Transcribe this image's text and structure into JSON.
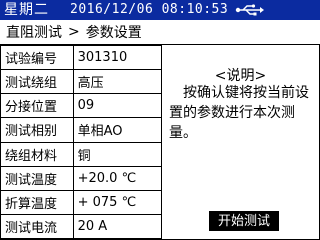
{
  "status_bar": {
    "weekday": "星期二",
    "datetime": "2016/12/06 08:10:53",
    "icon": "usb-icon",
    "bg_color": "#0b2ba0"
  },
  "breadcrumb": {
    "parent": "直阻测试",
    "separator": ">",
    "current": "参数设置"
  },
  "params": [
    {
      "label": "试验编号",
      "value": "301310"
    },
    {
      "label": "测试绕组",
      "value": "高压"
    },
    {
      "label": "分接位置",
      "value": "09"
    },
    {
      "label": "测试相别",
      "value": "单相AO"
    },
    {
      "label": "绕组材料",
      "value": "铜"
    },
    {
      "label": "测试温度",
      "value": "+20.0 ℃"
    },
    {
      "label": "折算温度",
      "value": "+ 075 ℃"
    },
    {
      "label": "测试电流",
      "value": "20 A"
    }
  ],
  "info": {
    "title": "<说明>",
    "text": "按确认键将按当前设置的参数进行本次测量。"
  },
  "actions": {
    "start_label": "开始测试"
  }
}
